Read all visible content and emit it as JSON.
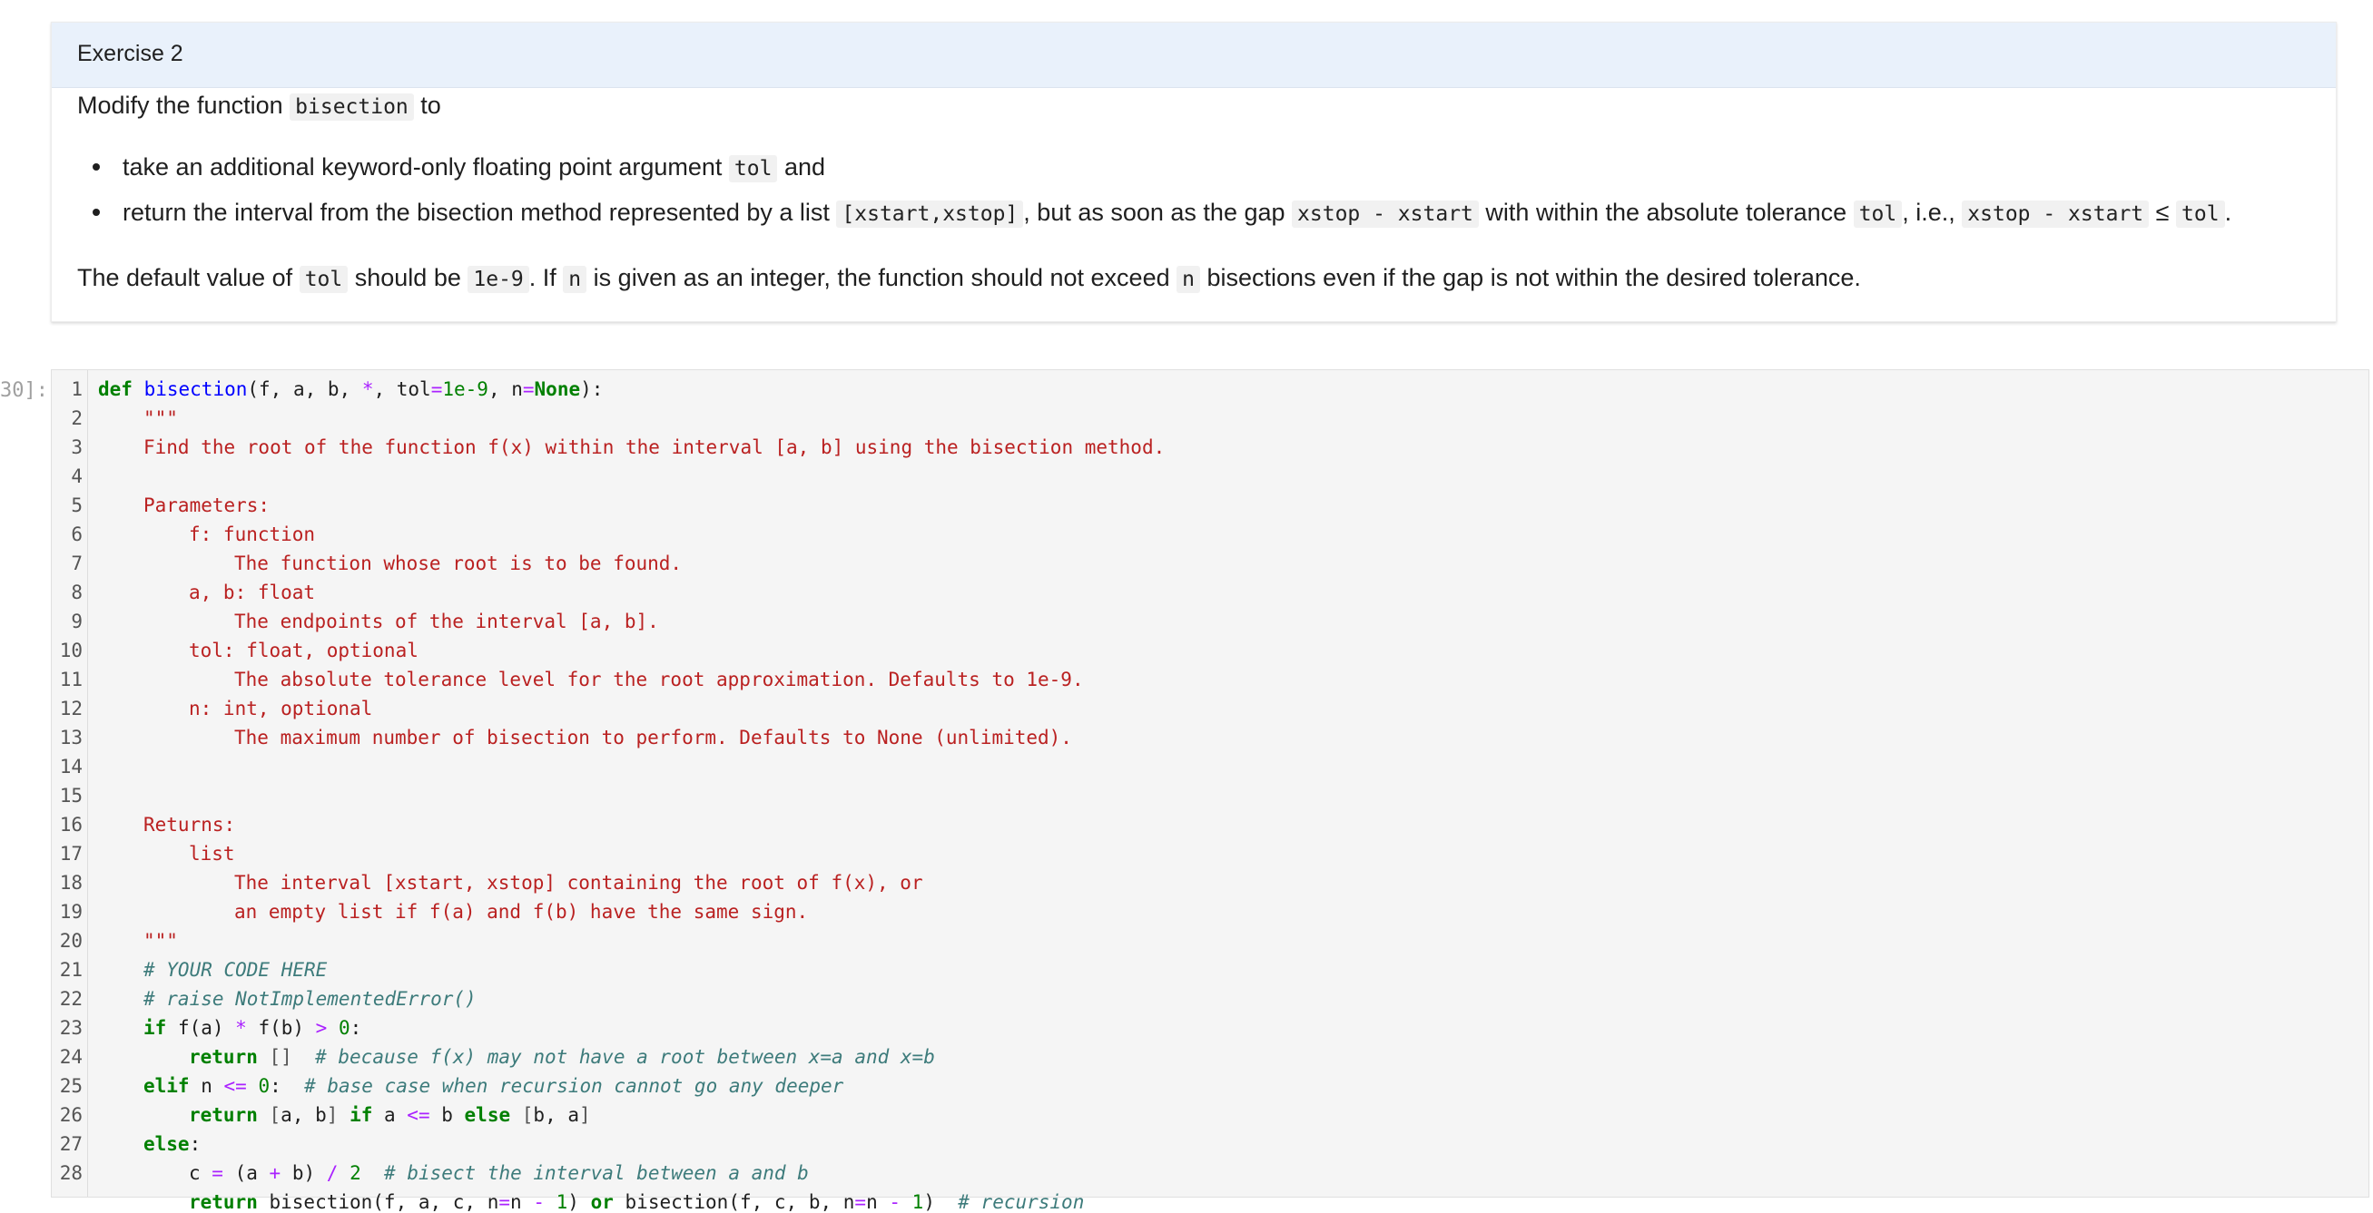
{
  "exercise": {
    "title": "Exercise 2",
    "intro_prefix": "Modify the function",
    "intro_code": "bisection",
    "intro_suffix": "to",
    "bullet1": {
      "prefix": "take an additional keyword-only floating point argument",
      "code": "tol",
      "suffix": "and"
    },
    "bullet2": {
      "p1": "return the interval from the bisection method represented by a list",
      "c1": "[xstart,xstop]",
      "p2": ", but as soon as the gap",
      "c2": "xstop - xstart",
      "p3": "with within the absolute tolerance",
      "c3": "tol",
      "p4": ", i.e.,",
      "c4": "xstop - xstart",
      "p5": "≤",
      "c5": "tol",
      "p6": "."
    },
    "default": {
      "p1": "The default value of",
      "c1": "tol",
      "p2": "should be",
      "c2": "1e-9",
      "p3": ". If",
      "c3": "n",
      "p4": "is given as an integer, the function should not exceed",
      "c4": "n",
      "p5": "bisections even if the gap is not within the desired tolerance."
    }
  },
  "code_cell": {
    "prompt": "30]:",
    "line_numbers": [
      "1",
      "2",
      "3",
      "4",
      "5",
      "6",
      "7",
      "8",
      "9",
      "10",
      "11",
      "12",
      "13",
      "14",
      "15",
      "16",
      "17",
      "18",
      "19",
      "20",
      "21",
      "22",
      "23",
      "24",
      "25",
      "26",
      "27",
      "28"
    ],
    "lines": {
      "l1": {
        "def": "def",
        "name": "bisection",
        "args": "(f, a, b, ",
        "star": "*",
        "tol": ", tol",
        "eq1": "=",
        "tolv": "1e-9",
        "nn": ", n",
        "eq2": "=",
        "none": "None",
        "end": "):"
      },
      "l2": "\"\"\"",
      "l3": "Find the root of the function f(x) within the interval [a, b] using the bisection method.",
      "l5": "Parameters:",
      "l6": "f: function",
      "l7": "The function whose root is to be found.",
      "l8": "a, b: float",
      "l9": "The endpoints of the interval [a, b].",
      "l10": "tol: float, optional",
      "l11": "The absolute tolerance level for the root approximation. Defaults to 1e-9.",
      "l12": "n: int, optional",
      "l13": "The maximum number of bisection to perform. Defaults to None (unlimited).",
      "l15": "Returns:",
      "l16": "list",
      "l17": "The interval [xstart, xstop] containing the root of f(x), or",
      "l18": "an empty list if f(a) and f(b) have the same sign.",
      "l19": "\"\"\"",
      "l20": "# YOUR CODE HERE",
      "l21": "# raise NotImplementedError()",
      "l22": {
        "kw": "if",
        "a": " f(a) ",
        "op1": "*",
        "b": " f(b) ",
        "op2": ">",
        "c": " ",
        "num": "0",
        "d": ":"
      },
      "l23": {
        "kw": "return",
        "a": " ",
        "br": "[]",
        "b": "  ",
        "cm": "# because f(x) may not have a root between x=a and x=b"
      },
      "l24": {
        "kw": "elif",
        "a": " n ",
        "op": "<=",
        "b": " ",
        "num": "0",
        "c": ":  ",
        "cm": "# base case when recursion cannot go any deeper"
      },
      "l25": {
        "kw1": "return",
        "a": " ",
        "br1": "[",
        "b": "a, b",
        "br2": "]",
        "c": " ",
        "kw2": "if",
        "d": " a ",
        "op": "<=",
        "e": " b ",
        "kw3": "else",
        "f": " ",
        "br3": "[",
        "g": "b, a",
        "br4": "]"
      },
      "l26": {
        "kw": "else",
        "a": ":"
      },
      "l27": {
        "a": "c ",
        "op1": "=",
        "b": " (a ",
        "op2": "+",
        "c": " b) ",
        "op3": "/",
        "d": " ",
        "num": "2",
        "e": "  ",
        "cm": "# bisect the interval between a and b"
      },
      "l28": {
        "kw1": "return",
        "a": " bisection(f, a, c, n",
        "eq1": "=",
        "b": "n ",
        "op1": "-",
        "c": " ",
        "num1": "1",
        "d": ") ",
        "kw2": "or",
        "e": " bisection(f, c, b, n",
        "eq2": "=",
        "f": "n ",
        "op2": "-",
        "g": " ",
        "num2": "1",
        "h": ")  ",
        "cm": "# recursion"
      }
    }
  }
}
